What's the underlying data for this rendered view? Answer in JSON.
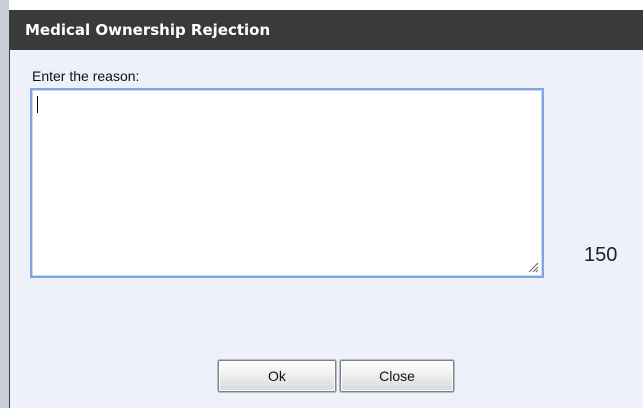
{
  "dialog": {
    "title": "Medical Ownership Rejection",
    "prompt_label": "Enter the reason:",
    "reason_field": {
      "value": "",
      "placeholder": ""
    },
    "char_count": "150",
    "buttons": {
      "ok_label": "Ok",
      "close_label": "Close"
    }
  },
  "colors": {
    "titlebar": "#3a3a3a",
    "dialog_bg": "#eef1fa",
    "field_border": "#7fa7dc"
  },
  "icons": {
    "resize_grip": "resize-grip-icon"
  }
}
